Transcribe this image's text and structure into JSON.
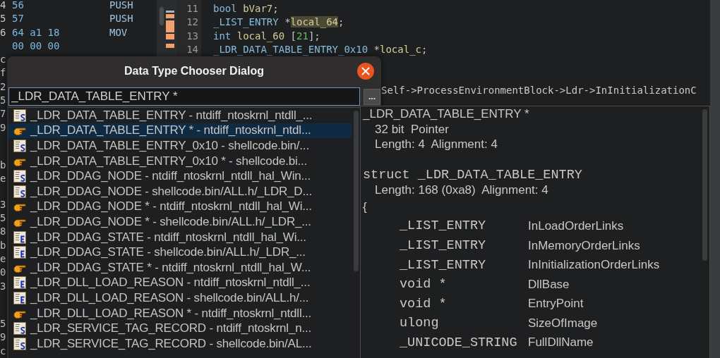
{
  "listing": {
    "rows": [
      {
        "address_tail": "4",
        "bytes": "56",
        "mnemonic": "PUSH"
      },
      {
        "address_tail": "5",
        "bytes": "57",
        "mnemonic": "PUSH"
      },
      {
        "address_tail": "6",
        "bytes": "64 a1 18",
        "mnemonic": "MOV"
      },
      {
        "bytes": "00 00 00"
      },
      {
        "address_tail": "c"
      },
      {
        "address_tail": "f"
      },
      {
        "address_tail": "2"
      },
      {
        "address_tail": "5"
      },
      {
        "address_tail": "7"
      },
      {
        "address_tail": "9"
      },
      {},
      {},
      {
        "address_tail": "b"
      },
      {
        "address_tail": "e"
      },
      {},
      {
        "address_tail": "3"
      },
      {
        "address_tail": "5"
      },
      {
        "address_tail": "8"
      },
      {
        "address_tail": "b"
      },
      {
        "address_tail": "e"
      },
      {
        "address_tail": "0"
      },
      {
        "address_tail": "3"
      },
      {},
      {},
      {
        "address_tail": "5"
      },
      {
        "address_tail": "9"
      },
      {
        "address_tail": "c"
      }
    ]
  },
  "decompiler": {
    "lines": [
      {
        "number": "11",
        "tokens": [
          {
            "kind": "type",
            "text": "bool"
          },
          {
            "kind": "var",
            "text": " bVar7"
          },
          {
            "kind": "punct",
            "text": ";"
          }
        ]
      },
      {
        "number": "12",
        "tokens": [
          {
            "kind": "type",
            "text": "_LIST_ENTRY"
          },
          {
            "kind": "punct",
            "text": " *"
          },
          {
            "kind": "highlight",
            "text": "local_64"
          },
          {
            "kind": "punct",
            "text": ";"
          }
        ]
      },
      {
        "number": "13",
        "tokens": [
          {
            "kind": "type",
            "text": "int"
          },
          {
            "kind": "var",
            "text": " local_60"
          },
          {
            "kind": "punct",
            "text": " ["
          },
          {
            "kind": "num",
            "text": "21"
          },
          {
            "kind": "punct",
            "text": "];"
          }
        ]
      },
      {
        "number": "14",
        "tokens": [
          {
            "kind": "type",
            "text": "_LDR_DATA_TABLE_ENTRY_0x10"
          },
          {
            "kind": "punct",
            "text": " *"
          },
          {
            "kind": "var",
            "text": "local_c"
          },
          {
            "kind": "punct",
            "text": ";"
          }
        ]
      },
      {
        "kind": "continuation",
        "tokens": [
          {
            "kind": "punct",
            "text": "Self->ProcessEnvironmentBlock->Ldr->InInitializationC"
          }
        ]
      }
    ]
  },
  "dialog": {
    "title": "Data Type Chooser Dialog",
    "search_field": {
      "value": "_LDR_DATA_TABLE_ENTRY *"
    },
    "browse_button": {
      "label": "..."
    },
    "results": [
      {
        "kind": "structure",
        "label": "_LDR_DATA_TABLE_ENTRY - ntdiff_ntoskrnl_ntdll_...",
        "selected": false
      },
      {
        "kind": "pointer",
        "label": "_LDR_DATA_TABLE_ENTRY * - ntdiff_ntoskrnl_ntdl...",
        "selected": true
      },
      {
        "kind": "structure",
        "label": "_LDR_DATA_TABLE_ENTRY_0x10 - shellcode.bin/...",
        "selected": false
      },
      {
        "kind": "pointer",
        "label": "_LDR_DATA_TABLE_ENTRY_0x10 * - shellcode.bi...",
        "selected": false
      },
      {
        "kind": "structure",
        "label": "_LDR_DDAG_NODE - ntdiff_ntoskrnl_ntdll_hal_Win...",
        "selected": false
      },
      {
        "kind": "structure",
        "label": "_LDR_DDAG_NODE - shellcode.bin/ALL.h/_LDR_D...",
        "selected": false
      },
      {
        "kind": "pointer",
        "label": "_LDR_DDAG_NODE * - ntdiff_ntoskrnl_ntdll_hal_Wi...",
        "selected": false
      },
      {
        "kind": "pointer",
        "label": "_LDR_DDAG_NODE * - shellcode.bin/ALL.h/_LDR_...",
        "selected": false
      },
      {
        "kind": "enum",
        "label": "_LDR_DDAG_STATE - ntdiff_ntoskrnl_ntdll_hal_Wi...",
        "selected": false
      },
      {
        "kind": "enum",
        "label": "_LDR_DDAG_STATE - shellcode.bin/ALL.h/_LDR_...",
        "selected": false
      },
      {
        "kind": "pointer",
        "label": "_LDR_DDAG_STATE * - ntdiff_ntoskrnl_ntdll_hal_W...",
        "selected": false
      },
      {
        "kind": "enum",
        "label": "_LDR_DLL_LOAD_REASON - ntdiff_ntoskrnl_ntdll_...",
        "selected": false
      },
      {
        "kind": "enum",
        "label": "_LDR_DLL_LOAD_REASON - shellcode.bin/ALL.h/...",
        "selected": false
      },
      {
        "kind": "pointer",
        "label": "_LDR_DLL_LOAD_REASON * - ntdiff_ntoskrnl_ntdll...",
        "selected": false
      },
      {
        "kind": "structure",
        "label": "_LDR_SERVICE_TAG_RECORD - ntdiff_ntoskrnl_n...",
        "selected": false
      },
      {
        "kind": "structure",
        "label": "_LDR_SERVICE_TAG_RECORD - shellcode.bin/AL...",
        "selected": false
      }
    ],
    "preview": {
      "title": "_LDR_DATA_TABLE_ENTRY *",
      "summary": [
        "32 bit  Pointer",
        "Length: 4  Alignment: 4"
      ],
      "struct_header": "struct _LDR_DATA_TABLE_ENTRY",
      "struct_summary": "Length: 168 (0xa8)  Alignment: 4",
      "open_brace": "{",
      "fields": [
        {
          "type": "_LIST_ENTRY",
          "name": "InLoadOrderLinks"
        },
        {
          "type": "_LIST_ENTRY",
          "name": "InMemoryOrderLinks"
        },
        {
          "type": "_LIST_ENTRY",
          "name": "InInitializationOrderLinks"
        },
        {
          "type": "void *",
          "name": "DllBase"
        },
        {
          "type": "void *",
          "name": "EntryPoint"
        },
        {
          "type": "ulong",
          "name": "SizeOfImage"
        },
        {
          "type": "_UNICODE_STRING",
          "name": "FullDllName"
        }
      ]
    }
  }
}
